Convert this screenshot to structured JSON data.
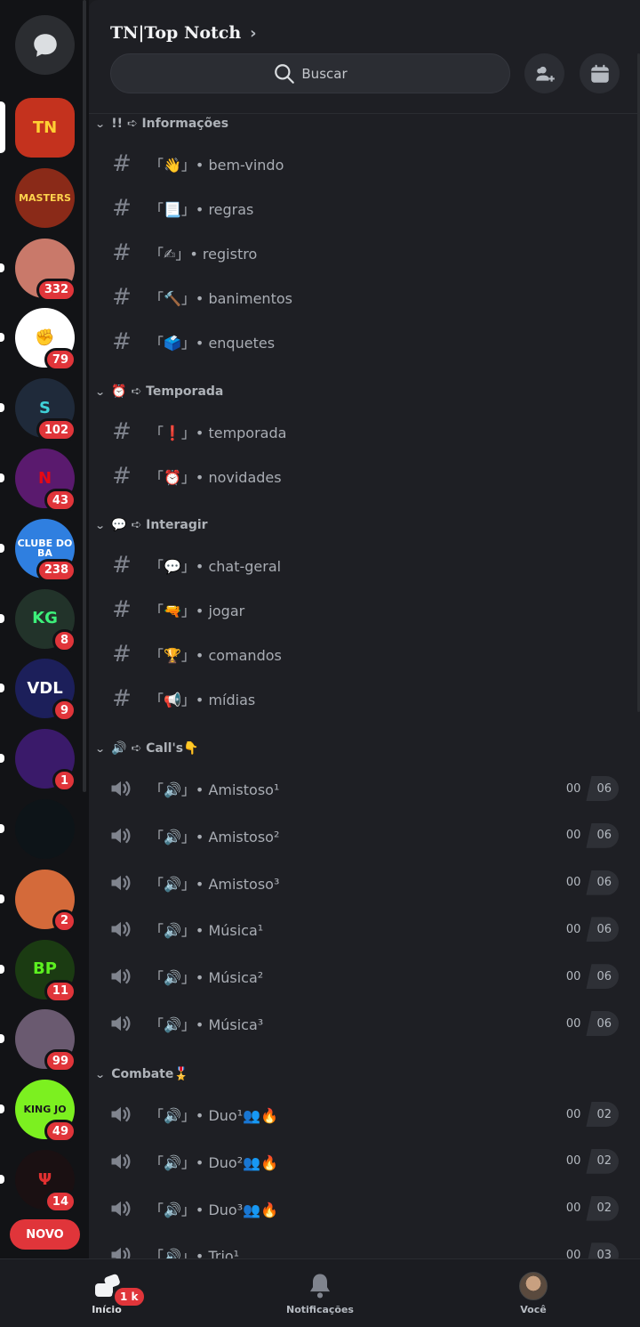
{
  "server": {
    "title": "TN|Top Notch",
    "title_chevron": "›"
  },
  "search": {
    "label": "Buscar"
  },
  "rail": {
    "novo_label": "NOVO",
    "servers": [
      {
        "key": "tn",
        "text": "TN",
        "badge": "",
        "bg": "#c4321e",
        "fg": "#ffcf33"
      },
      {
        "key": "masters",
        "text": "MASTERS",
        "badge": "",
        "bg": "#8a2a18",
        "fg": "#ffd34d"
      },
      {
        "key": "anime",
        "text": "",
        "badge": "332",
        "bg": "#c9796a",
        "fg": "#fff"
      },
      {
        "key": "fist",
        "text": "✊",
        "badge": "79",
        "bg": "#ffffff",
        "fg": "#222"
      },
      {
        "key": "cyan",
        "text": "S",
        "badge": "102",
        "bg": "#1f2a3a",
        "fg": "#3fd1d8"
      },
      {
        "key": "netflix",
        "text": "N",
        "badge": "43",
        "bg": "#5a1a6e",
        "fg": "#e50914"
      },
      {
        "key": "clube",
        "text": "CLUBE DO BA",
        "badge": "238",
        "bg": "#2f7fe0",
        "fg": "#fff"
      },
      {
        "key": "kgen",
        "text": "KG",
        "badge": "8",
        "bg": "#22332a",
        "fg": "#3df07a"
      },
      {
        "key": "vdl",
        "text": "VDL",
        "badge": "9",
        "bg": "#1c1f5a",
        "fg": "#fff"
      },
      {
        "key": "neon",
        "text": "",
        "badge": "1",
        "bg": "#3a1a6a",
        "fg": "#fff"
      },
      {
        "key": "wing",
        "text": "",
        "badge": "",
        "bg": "#0d1418",
        "fg": "#2ad0c8"
      },
      {
        "key": "robot",
        "text": "",
        "badge": "2",
        "bg": "#d46a3a",
        "fg": "#fff"
      },
      {
        "key": "bp",
        "text": "BP",
        "badge": "11",
        "bg": "#1b3b12",
        "fg": "#5cf020"
      },
      {
        "key": "photo",
        "text": "",
        "badge": "99",
        "bg": "#6a5a70",
        "fg": "#fff"
      },
      {
        "key": "kingjo",
        "text": "KING JO",
        "badge": "49",
        "bg": "#7cf020",
        "fg": "#1a1a1a"
      },
      {
        "key": "trident",
        "text": "Ψ",
        "badge": "14",
        "bg": "#1a1012",
        "fg": "#e03030"
      }
    ]
  },
  "categories": [
    {
      "label": "!! ➪ Informações",
      "channels": [
        {
          "type": "text",
          "name": "「👋」• bem-vindo"
        },
        {
          "type": "text",
          "name": "「📃」• regras"
        },
        {
          "type": "text",
          "name": "「✍」• registro"
        },
        {
          "type": "text",
          "name": "「🔨」• banimentos"
        },
        {
          "type": "text",
          "name": "「🗳️」• enquetes"
        }
      ]
    },
    {
      "label": "⏰ ➪ Temporada",
      "channels": [
        {
          "type": "text",
          "name": "「❗」• temporada"
        },
        {
          "type": "text",
          "name": "「⏰」• novidades"
        }
      ]
    },
    {
      "label": "💬 ➪ Interagir",
      "channels": [
        {
          "type": "text",
          "name": "「💬」• chat-geral"
        },
        {
          "type": "text",
          "name": "「🔫」• jogar"
        },
        {
          "type": "text",
          "name": "「🏆」• comandos"
        },
        {
          "type": "text",
          "name": "「📢」• mídias"
        }
      ]
    },
    {
      "label": "🔊 ➪ Call's👇",
      "channels": [
        {
          "type": "voice",
          "name": "「🔊」• Amistoso¹",
          "count": "00",
          "limit": "06"
        },
        {
          "type": "voice",
          "name": "「🔊」• Amistoso²",
          "count": "00",
          "limit": "06"
        },
        {
          "type": "voice",
          "name": "「🔊」• Amistoso³",
          "count": "00",
          "limit": "06"
        },
        {
          "type": "voice",
          "name": "「🔊」• Música¹",
          "count": "00",
          "limit": "06"
        },
        {
          "type": "voice",
          "name": "「🔊」• Música²",
          "count": "00",
          "limit": "06"
        },
        {
          "type": "voice",
          "name": "「🔊」• Música³",
          "count": "00",
          "limit": "06"
        }
      ]
    },
    {
      "label": "Combate🎖️",
      "channels": [
        {
          "type": "voice",
          "name": "「🔊」• Duo¹👥🔥",
          "count": "00",
          "limit": "02"
        },
        {
          "type": "voice",
          "name": "「🔊」• Duo²👥🔥",
          "count": "00",
          "limit": "02"
        },
        {
          "type": "voice",
          "name": "「🔊」• Duo³👥🔥",
          "count": "00",
          "limit": "02"
        },
        {
          "type": "voice",
          "name": "「🔊」• Trio¹",
          "count": "00",
          "limit": "03"
        }
      ]
    }
  ],
  "bottom_nav": {
    "home_label": "Início",
    "home_badge": "1 k",
    "notifications_label": "Notificações",
    "you_label": "Você"
  },
  "colors": {
    "accent_red": "#e0353a",
    "background": "#1e1f24",
    "rail": "#121316"
  }
}
